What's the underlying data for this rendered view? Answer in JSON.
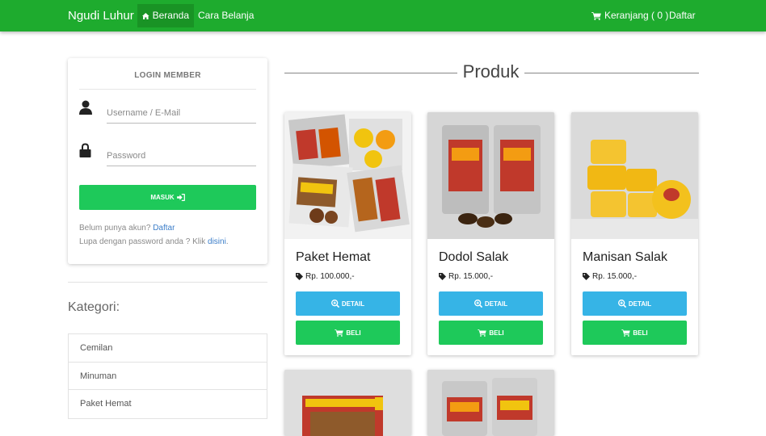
{
  "navbar": {
    "brand": "Ngudi Luhur",
    "home": "Beranda",
    "guide": "Cara Belanja",
    "cart": "Keranjang ( 0 )",
    "register": "Daftar"
  },
  "login": {
    "title": "LOGIN MEMBER",
    "username_placeholder": "Username / E-Mail",
    "password_placeholder": "Password",
    "submit": "MASUK",
    "no_account": "Belum punya akun?",
    "register_link": "Daftar",
    "forgot": "Lupa dengan password anda ? Klik",
    "forgot_link": "disini",
    "forgot_end": "."
  },
  "categories": {
    "title": "Kategori:",
    "items": [
      "Cemilan",
      "Minuman",
      "Paket Hemat"
    ]
  },
  "products": {
    "title": "Produk",
    "detail_label": "DETAIL",
    "buy_label": "BELI",
    "items": [
      {
        "name": "Paket Hemat",
        "price": "Rp. 100.000,-"
      },
      {
        "name": "Dodol Salak",
        "price": "Rp. 15.000,-"
      },
      {
        "name": "Manisan Salak",
        "price": "Rp. 15.000,-"
      },
      {
        "name": "",
        "price": ""
      },
      {
        "name": "",
        "price": ""
      }
    ]
  },
  "colors": {
    "navbar": "#1eab2e",
    "primary_green": "#1ec95a",
    "info_blue": "#36b4e6",
    "link": "#3c7ec9"
  }
}
